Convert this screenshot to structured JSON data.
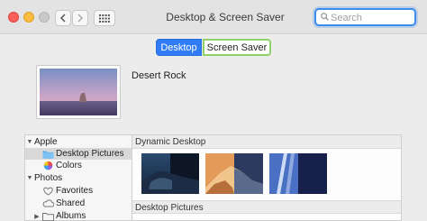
{
  "window": {
    "title": "Desktop & Screen Saver"
  },
  "search": {
    "placeholder": "Search"
  },
  "tabs": [
    {
      "label": "Desktop",
      "active": true
    },
    {
      "label": "Screen Saver",
      "active": false
    }
  ],
  "current": {
    "name": "Desert Rock"
  },
  "sidebar": {
    "groups": [
      {
        "label": "Apple",
        "expanded": true,
        "items": [
          {
            "label": "Desktop Pictures",
            "icon": "folder-icon",
            "selected": true
          },
          {
            "label": "Colors",
            "icon": "color-wheel-icon",
            "selected": false
          }
        ]
      },
      {
        "label": "Photos",
        "expanded": true,
        "items": [
          {
            "label": "Favorites",
            "icon": "heart-icon",
            "selected": false
          },
          {
            "label": "Shared",
            "icon": "cloud-icon",
            "selected": false
          },
          {
            "label": "Albums",
            "icon": "folder-icon",
            "selected": false
          }
        ]
      }
    ]
  },
  "sections": [
    {
      "title": "Dynamic Desktop"
    },
    {
      "title": "Desktop Pictures"
    }
  ],
  "colors": {
    "accent": "#2f7cf6",
    "highlight": "#8fd16b"
  }
}
